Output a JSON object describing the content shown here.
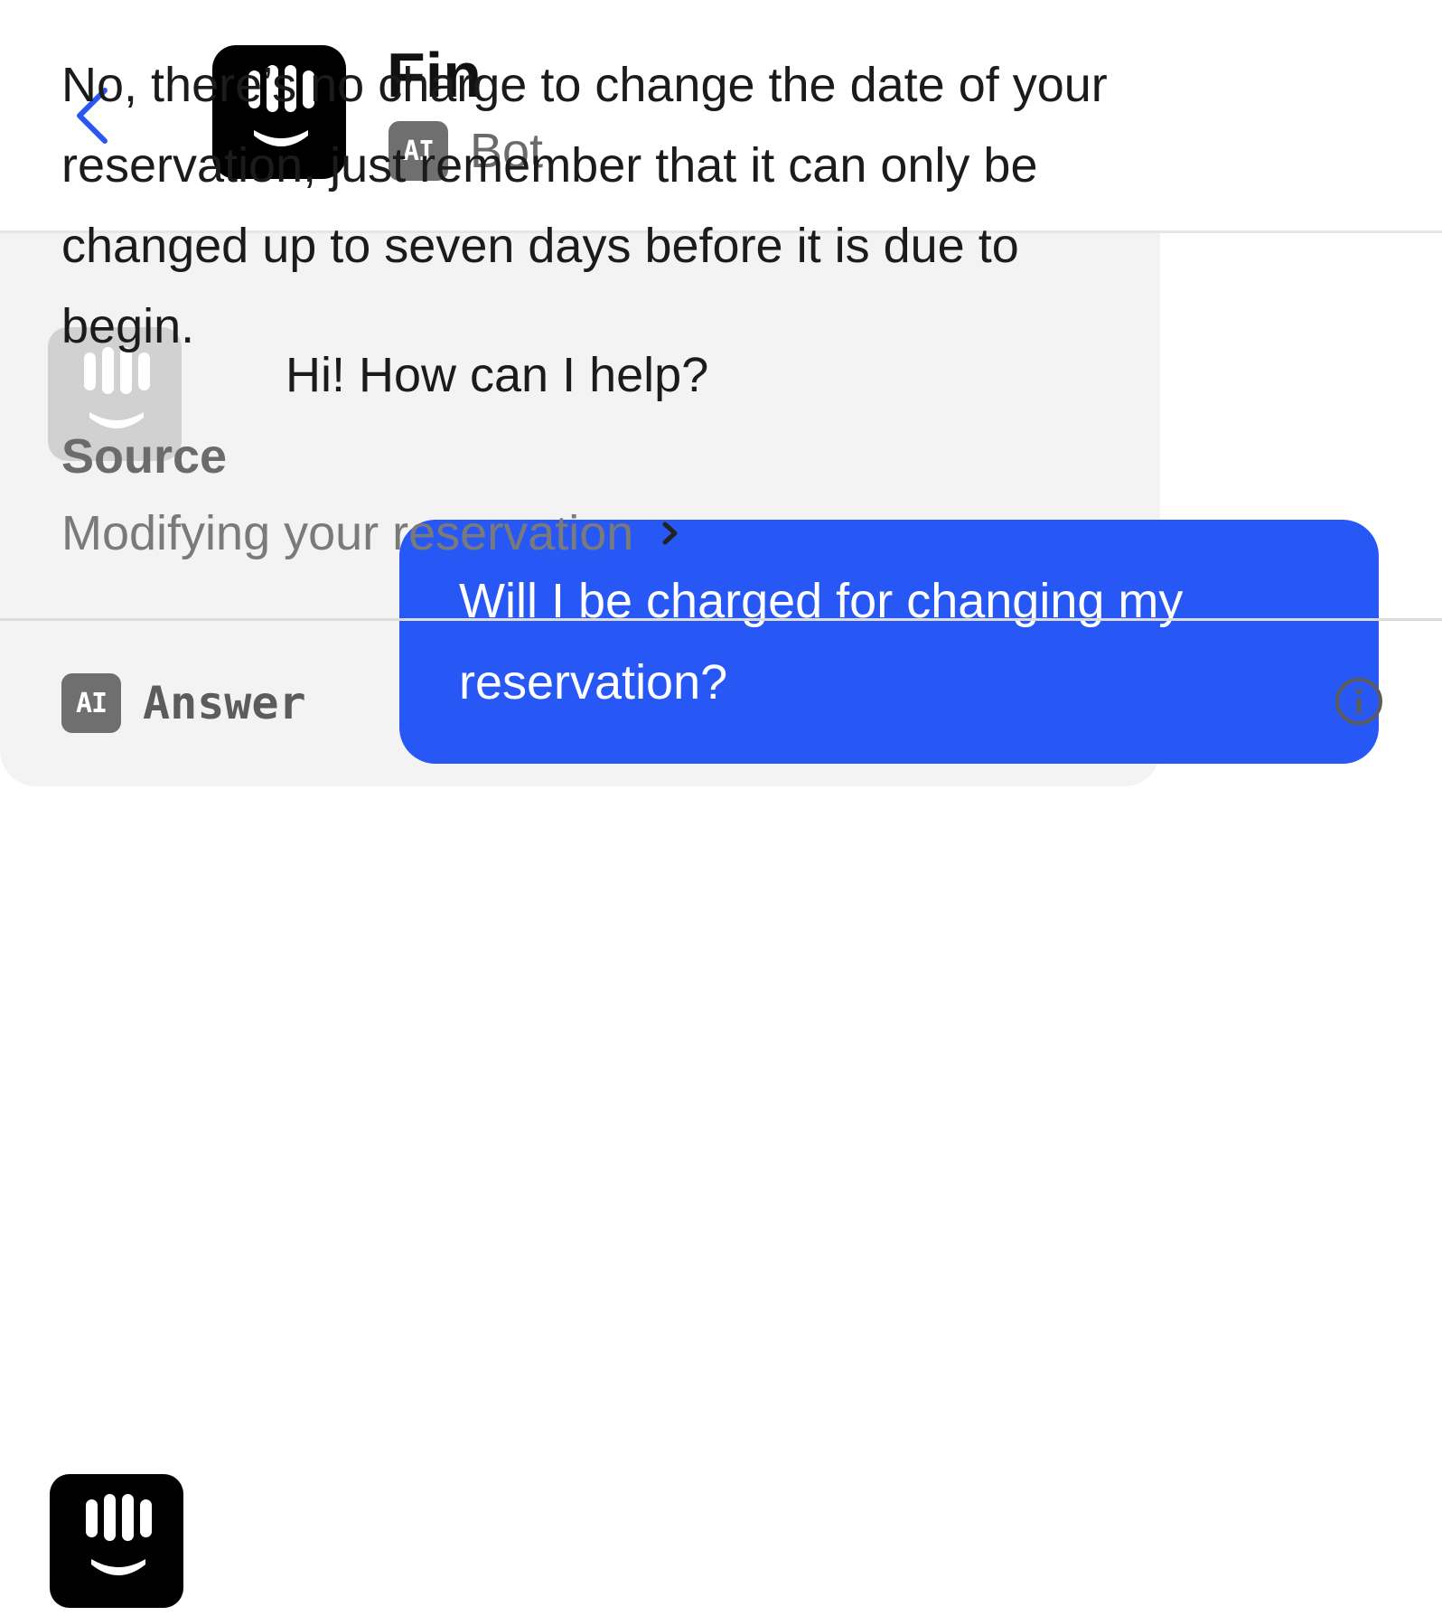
{
  "header": {
    "name": "Fin",
    "ai_badge": "AI",
    "role": "Bot"
  },
  "messages": [
    {
      "sender": "bot",
      "text": "Hi! How can I help?"
    },
    {
      "sender": "user",
      "text": "Will I be charged for changing my reservation?"
    },
    {
      "sender": "bot",
      "text": "No, there’s no charge to change the date of your reservation, just remember that it can only be changed up to seven days before it is due to begin.",
      "source_heading": "Source",
      "source_link": "Modifying your reservation",
      "footer_badge": "AI",
      "footer_label": "Answer"
    }
  ],
  "colors": {
    "user_bubble": "#2758f6",
    "bot_bubble": "#f3f3f3",
    "back_icon": "#2758f6"
  },
  "icons": {
    "back": "chevron-left-icon",
    "avatar": "fin-logo-icon",
    "source": "chevron-right-icon",
    "info": "info-icon"
  }
}
